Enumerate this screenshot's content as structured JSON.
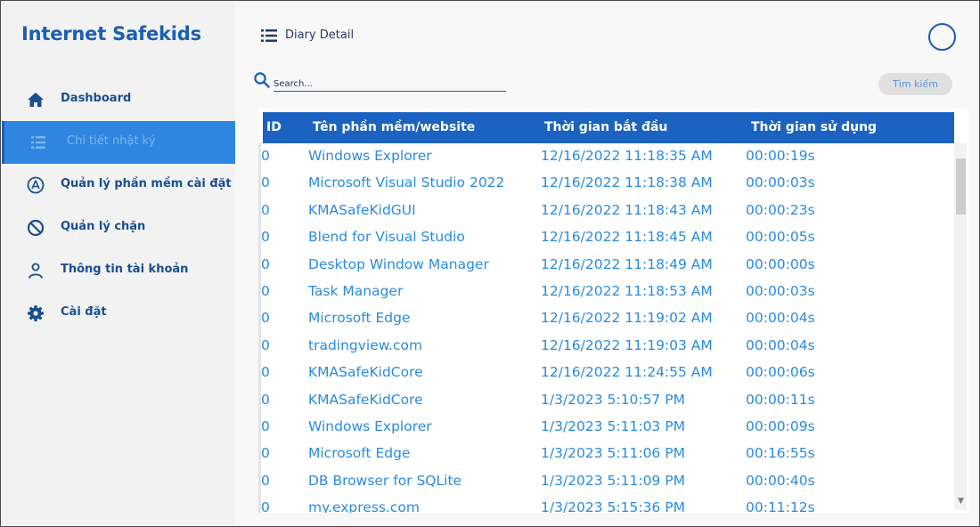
{
  "app": {
    "title": "Internet Safekids"
  },
  "sidebar": {
    "items": [
      {
        "label": "Dashboard",
        "icon": "home-icon"
      },
      {
        "label": "Chi tiết nhật ký",
        "icon": "list-icon",
        "active": true
      },
      {
        "label": "Quản lý phần mềm cài đặt",
        "icon": "app-store-icon"
      },
      {
        "label": "Quản lý chặn",
        "icon": "block-icon"
      },
      {
        "label": "Thông tin tài khoản",
        "icon": "user-icon"
      },
      {
        "label": "Cài đặt",
        "icon": "gear-icon"
      }
    ]
  },
  "header": {
    "title": "Diary Detail",
    "icon": "list-icon",
    "profile_icon": "profile-circle-icon"
  },
  "search": {
    "placeholder": "Search...",
    "value": "",
    "button_label": "Tìm kiếm"
  },
  "table": {
    "columns": [
      "ID",
      "Tên phần mềm/website",
      "Thời gian bắt đầu",
      "Thời gian sử dụng"
    ],
    "rows": [
      [
        "0",
        "Windows Explorer",
        "12/16/2022 11:18:35 AM",
        "00:00:19s"
      ],
      [
        "0",
        "Microsoft Visual Studio 2022",
        "12/16/2022 11:18:38 AM",
        "00:00:03s"
      ],
      [
        "0",
        "KMASafeKidGUI",
        "12/16/2022 11:18:43 AM",
        "00:00:23s"
      ],
      [
        "0",
        "Blend for Visual Studio",
        "12/16/2022 11:18:45 AM",
        "00:00:05s"
      ],
      [
        "0",
        "Desktop Window Manager",
        "12/16/2022 11:18:49 AM",
        "00:00:00s"
      ],
      [
        "0",
        "Task Manager",
        "12/16/2022 11:18:53 AM",
        "00:00:03s"
      ],
      [
        "0",
        "Microsoft Edge",
        "12/16/2022 11:19:02 AM",
        "00:00:04s"
      ],
      [
        "0",
        "tradingview.com",
        "12/16/2022 11:19:03 AM",
        "00:00:04s"
      ],
      [
        "0",
        "KMASafeKidCore",
        "12/16/2022 11:24:55 AM",
        "00:00:06s"
      ],
      [
        "0",
        "KMASafeKidCore",
        "1/3/2023 5:10:57 PM",
        "00:00:11s"
      ],
      [
        "0",
        "Windows Explorer",
        "1/3/2023 5:11:03 PM",
        "00:00:09s"
      ],
      [
        "0",
        "Microsoft Edge",
        "1/3/2023 5:11:06 PM",
        "00:16:55s"
      ],
      [
        "0",
        "DB Browser for SQLite",
        "1/3/2023 5:11:09 PM",
        "00:00:40s"
      ],
      [
        "0",
        "my.express.com",
        "1/3/2023 5:15:36 PM",
        "00:11:12s"
      ]
    ]
  },
  "colors": {
    "brand": "#1a5fb4",
    "active_nav": "#2f86e0",
    "table_header": "#1c63c1",
    "row_text": "#2a8be0"
  }
}
